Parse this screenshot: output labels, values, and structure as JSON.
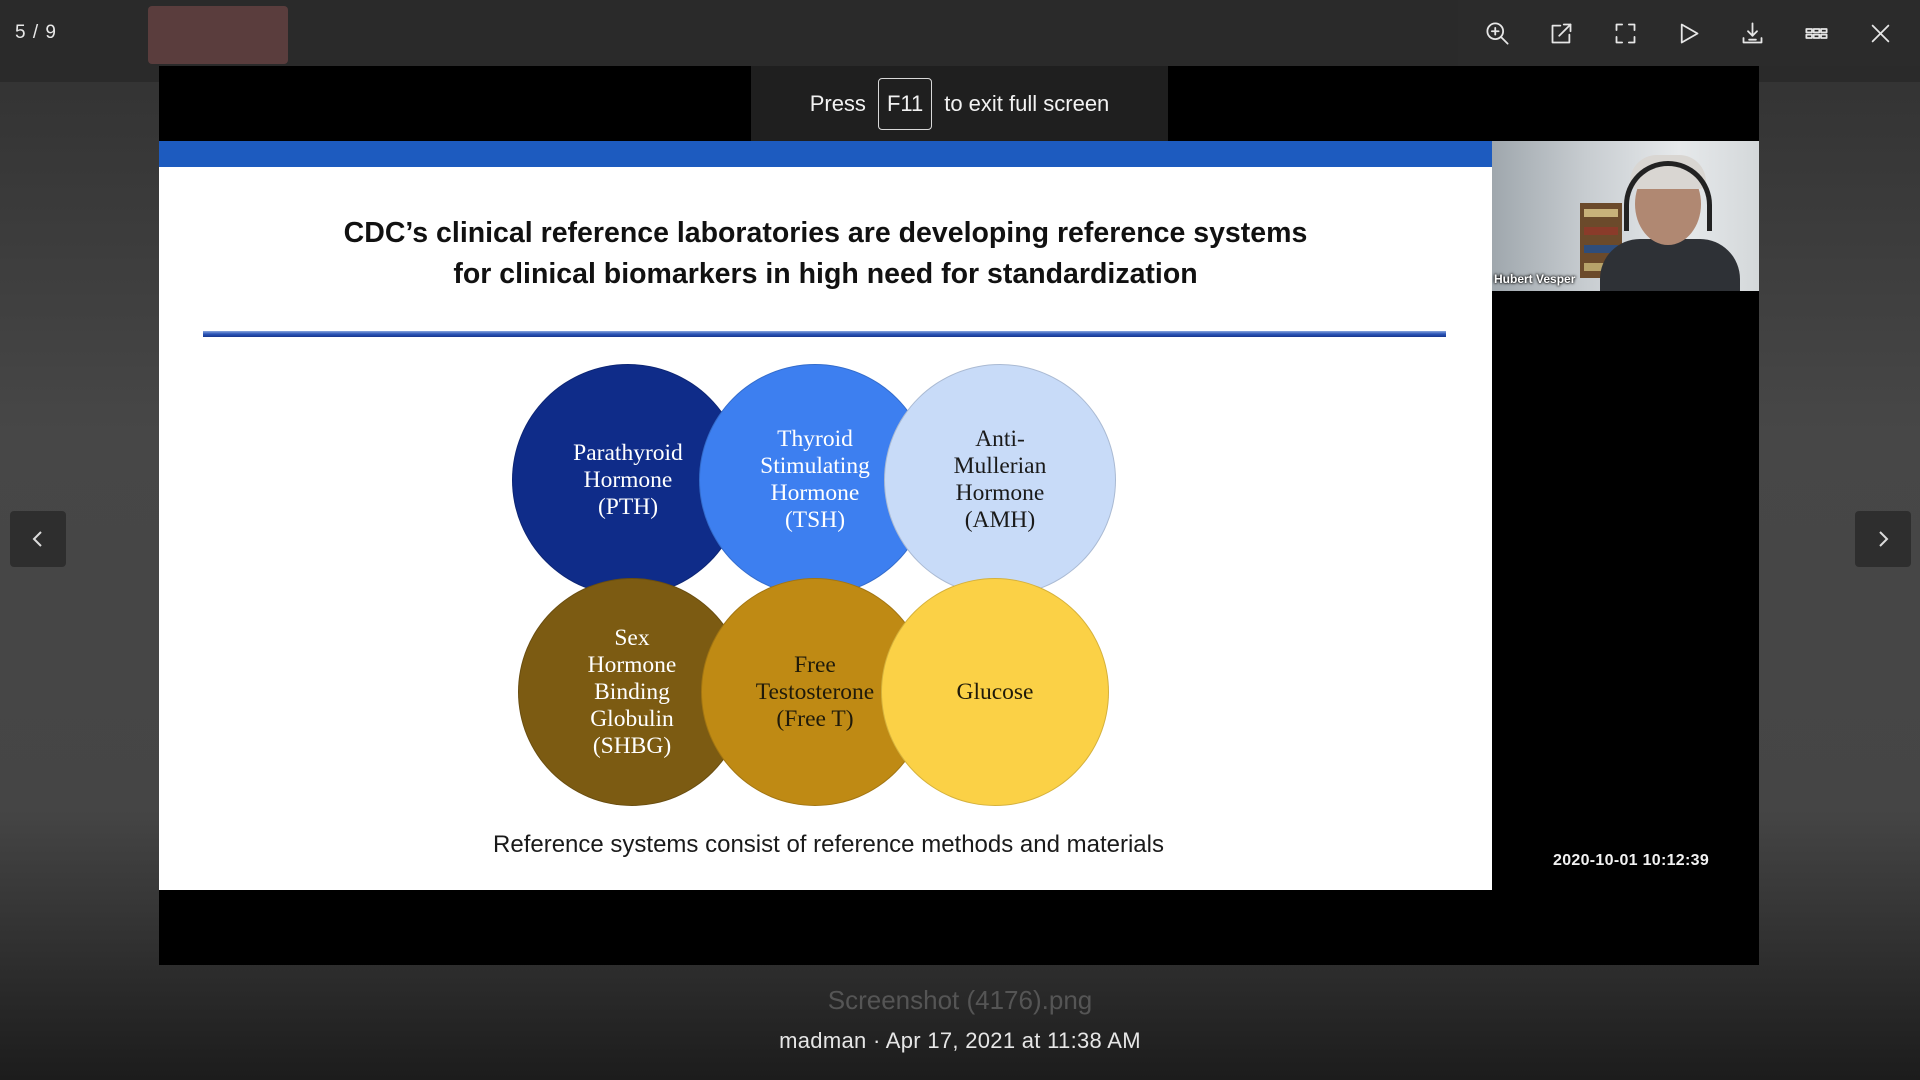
{
  "viewer": {
    "counter": "5 / 9",
    "toolbar": {
      "zoom_icon": "zoom-in-icon",
      "open_icon": "open-external-icon",
      "fullscreen_icon": "fullscreen-icon",
      "slideshow_icon": "play-icon",
      "download_icon": "download-icon",
      "grid_icon": "grid-icon",
      "close_icon": "close-icon"
    },
    "file_name": "Screenshot (4176).png",
    "meta": "madman · Apr 17, 2021 at 11:38 AM"
  },
  "fullscreen_hint": {
    "press": "Press",
    "key": "F11",
    "rest": "to exit full screen"
  },
  "slide": {
    "title_line1": "CDC’s clinical reference laboratories are developing reference systems",
    "title_line2": "for clinical biomarkers in high need for standardization",
    "circles": [
      {
        "label": "Parathyroid\nHormone\n(PTH)",
        "color": "#0f2c89"
      },
      {
        "label": "Thyroid\nStimulating\nHormone\n(TSH)",
        "color": "#3d7ff0"
      },
      {
        "label": "Anti-\nMullerian\nHormone\n(AMH)",
        "color": "#c8dbf8"
      },
      {
        "label": "Sex\nHormone\nBinding\nGlobulin\n(SHBG)",
        "color": "#7c5b12"
      },
      {
        "label": "Free\nTestosterone\n(Free T)",
        "color": "#bf8a14"
      },
      {
        "label": "Glucose",
        "color": "#fbd146"
      }
    ],
    "caption": "Reference systems consist of reference methods and materials",
    "accent_color": "#1d5bbf",
    "bottom_stripes": [
      "#1d5bbf",
      "#e0a81c",
      "#5a2a1a",
      "#0f7a52",
      "#c9b98a",
      "#9aa7ad"
    ]
  },
  "video": {
    "speaker_name": "Hubert Vesper",
    "timestamp": "2020-10-01  10:12:39"
  }
}
